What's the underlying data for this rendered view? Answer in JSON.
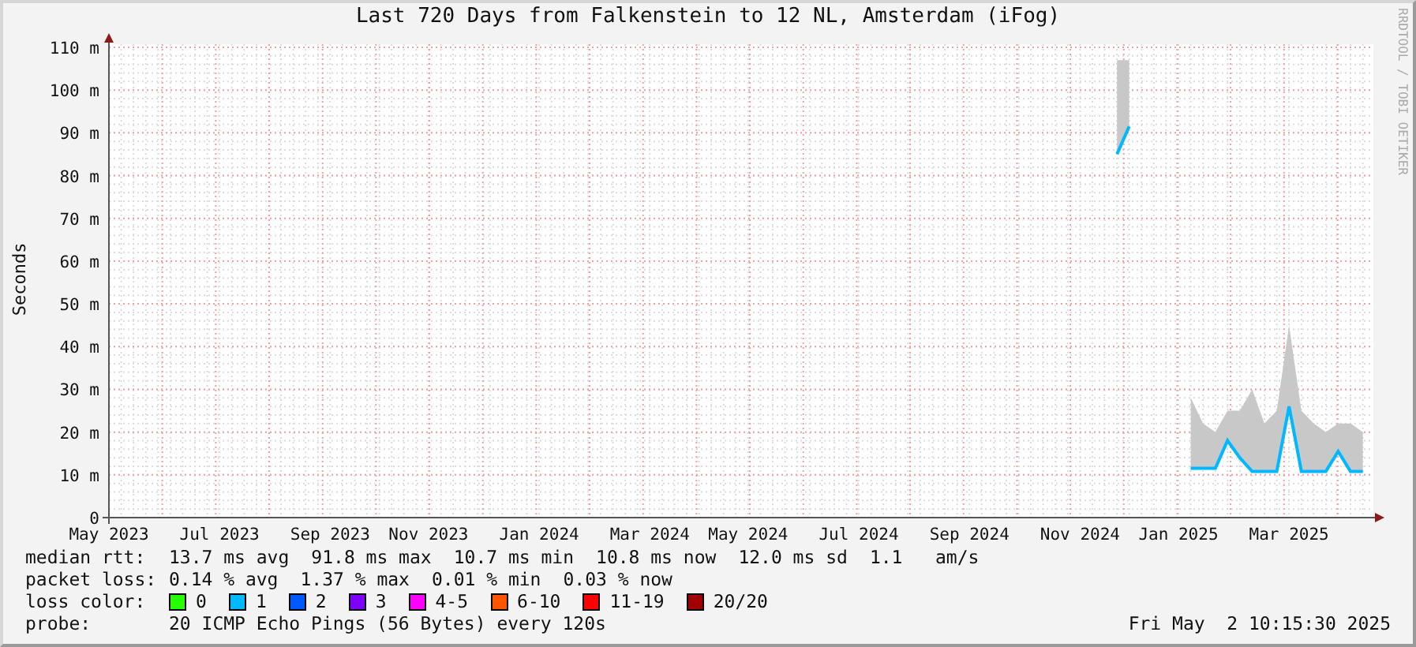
{
  "title": "Last 720 Days from Falkenstein to 12 NL, Amsterdam (iFog)",
  "credit": "RRDTOOL / TOBI OETIKER",
  "chart_data": {
    "type": "line",
    "ylabel": "Seconds",
    "grid": true,
    "categories": [
      "May 2023",
      null,
      null,
      null,
      null,
      null,
      null,
      null,
      null,
      "Jul 2023",
      null,
      null,
      null,
      null,
      null,
      null,
      null,
      null,
      "Sep 2023",
      null,
      null,
      null,
      null,
      null,
      null,
      null,
      "Nov 2023",
      null,
      null,
      null,
      null,
      null,
      null,
      null,
      null,
      "Jan 2024",
      null,
      null,
      null,
      null,
      null,
      null,
      null,
      null,
      "Mar 2024",
      null,
      null,
      null,
      null,
      null,
      null,
      null,
      "May 2024",
      null,
      null,
      null,
      null,
      null,
      null,
      null,
      null,
      "Jul 2024",
      null,
      null,
      null,
      null,
      null,
      null,
      null,
      null,
      "Sep 2024",
      null,
      null,
      null,
      null,
      null,
      null,
      null,
      null,
      "Nov 2024",
      null,
      null,
      null,
      null,
      null,
      null,
      null,
      "Jan 2025",
      null,
      null,
      null,
      null,
      null,
      null,
      null,
      null,
      "Mar 2025",
      null,
      null,
      null,
      null,
      null,
      null
    ],
    "series": [
      {
        "type": "area",
        "color": "#c8c8c8",
        "values": [
          null,
          null,
          null,
          null,
          null,
          null,
          null,
          null,
          null,
          null,
          null,
          null,
          null,
          null,
          null,
          null,
          null,
          null,
          null,
          null,
          null,
          null,
          null,
          null,
          null,
          null,
          null,
          null,
          null,
          null,
          null,
          null,
          null,
          null,
          null,
          null,
          null,
          null,
          null,
          null,
          null,
          null,
          null,
          null,
          null,
          null,
          null,
          null,
          null,
          null,
          null,
          null,
          null,
          null,
          null,
          null,
          null,
          null,
          null,
          null,
          null,
          null,
          null,
          null,
          null,
          null,
          null,
          null,
          null,
          null,
          null,
          null,
          null,
          null,
          null,
          null,
          null,
          null,
          null,
          null,
          null,
          null,
          107,
          107,
          null,
          null,
          null,
          null,
          28,
          22,
          20,
          25,
          25,
          30,
          22,
          25,
          45,
          25,
          22,
          20,
          22,
          22,
          20
        ]
      },
      {
        "type": "line",
        "color": "#00b8ff",
        "values": [
          null,
          null,
          null,
          null,
          null,
          null,
          null,
          null,
          null,
          null,
          null,
          null,
          null,
          null,
          null,
          null,
          null,
          null,
          null,
          null,
          null,
          null,
          null,
          null,
          null,
          null,
          null,
          null,
          null,
          null,
          null,
          null,
          null,
          null,
          null,
          null,
          null,
          null,
          null,
          null,
          null,
          null,
          null,
          null,
          null,
          null,
          null,
          null,
          null,
          null,
          null,
          null,
          null,
          null,
          null,
          null,
          null,
          null,
          null,
          null,
          null,
          null,
          null,
          null,
          null,
          null,
          null,
          null,
          null,
          null,
          null,
          null,
          null,
          null,
          null,
          null,
          null,
          null,
          null,
          null,
          null,
          null,
          85,
          91.5,
          null,
          null,
          null,
          null,
          11.5,
          11.5,
          11.5,
          18,
          14,
          10.8,
          10.8,
          10.8,
          26,
          10.8,
          10.8,
          10.8,
          15.5,
          10.8,
          10.8
        ]
      }
    ],
    "ylim": [
      0,
      110
    ],
    "yticks": [
      {
        "value": 0,
        "label": "0"
      },
      {
        "value": 10,
        "label": "10 m"
      },
      {
        "value": 20,
        "label": "20 m"
      },
      {
        "value": 30,
        "label": "30 m"
      },
      {
        "value": 40,
        "label": "40 m"
      },
      {
        "value": 50,
        "label": "50 m"
      },
      {
        "value": 60,
        "label": "60 m"
      },
      {
        "value": 70,
        "label": "70 m"
      },
      {
        "value": 80,
        "label": "80 m"
      },
      {
        "value": 90,
        "label": "90 m"
      },
      {
        "value": 100,
        "label": "100 m"
      },
      {
        "value": 110,
        "label": "110 m"
      }
    ]
  },
  "legend": {
    "median_rtt": {
      "label": "median rtt:",
      "values": [
        "13.7 ms avg",
        "91.8 ms max",
        "10.7 ms min",
        "10.8 ms now",
        "12.0 ms sd",
        "1.1   am/s"
      ]
    },
    "packet_loss": {
      "label": "packet loss:",
      "values": [
        "0.14 % avg",
        "1.37 % max",
        "0.01 % min",
        "0.03 % now"
      ]
    },
    "loss_color": {
      "label": "loss color:",
      "items": [
        {
          "label": "0",
          "color": "#26ff00"
        },
        {
          "label": "1",
          "color": "#00b8ff"
        },
        {
          "label": "2",
          "color": "#0059ff"
        },
        {
          "label": "3",
          "color": "#7e00ff"
        },
        {
          "label": "4-5",
          "color": "#ff00ff"
        },
        {
          "label": "6-10",
          "color": "#ff5500"
        },
        {
          "label": "11-19",
          "color": "#ff0000"
        },
        {
          "label": "20/20",
          "color": "#a10000"
        }
      ]
    },
    "probe": {
      "label": "probe:",
      "value": "20 ICMP Echo Pings (56 Bytes) every 120s"
    },
    "timestamp": "Fri May  2 10:15:30 2025"
  }
}
